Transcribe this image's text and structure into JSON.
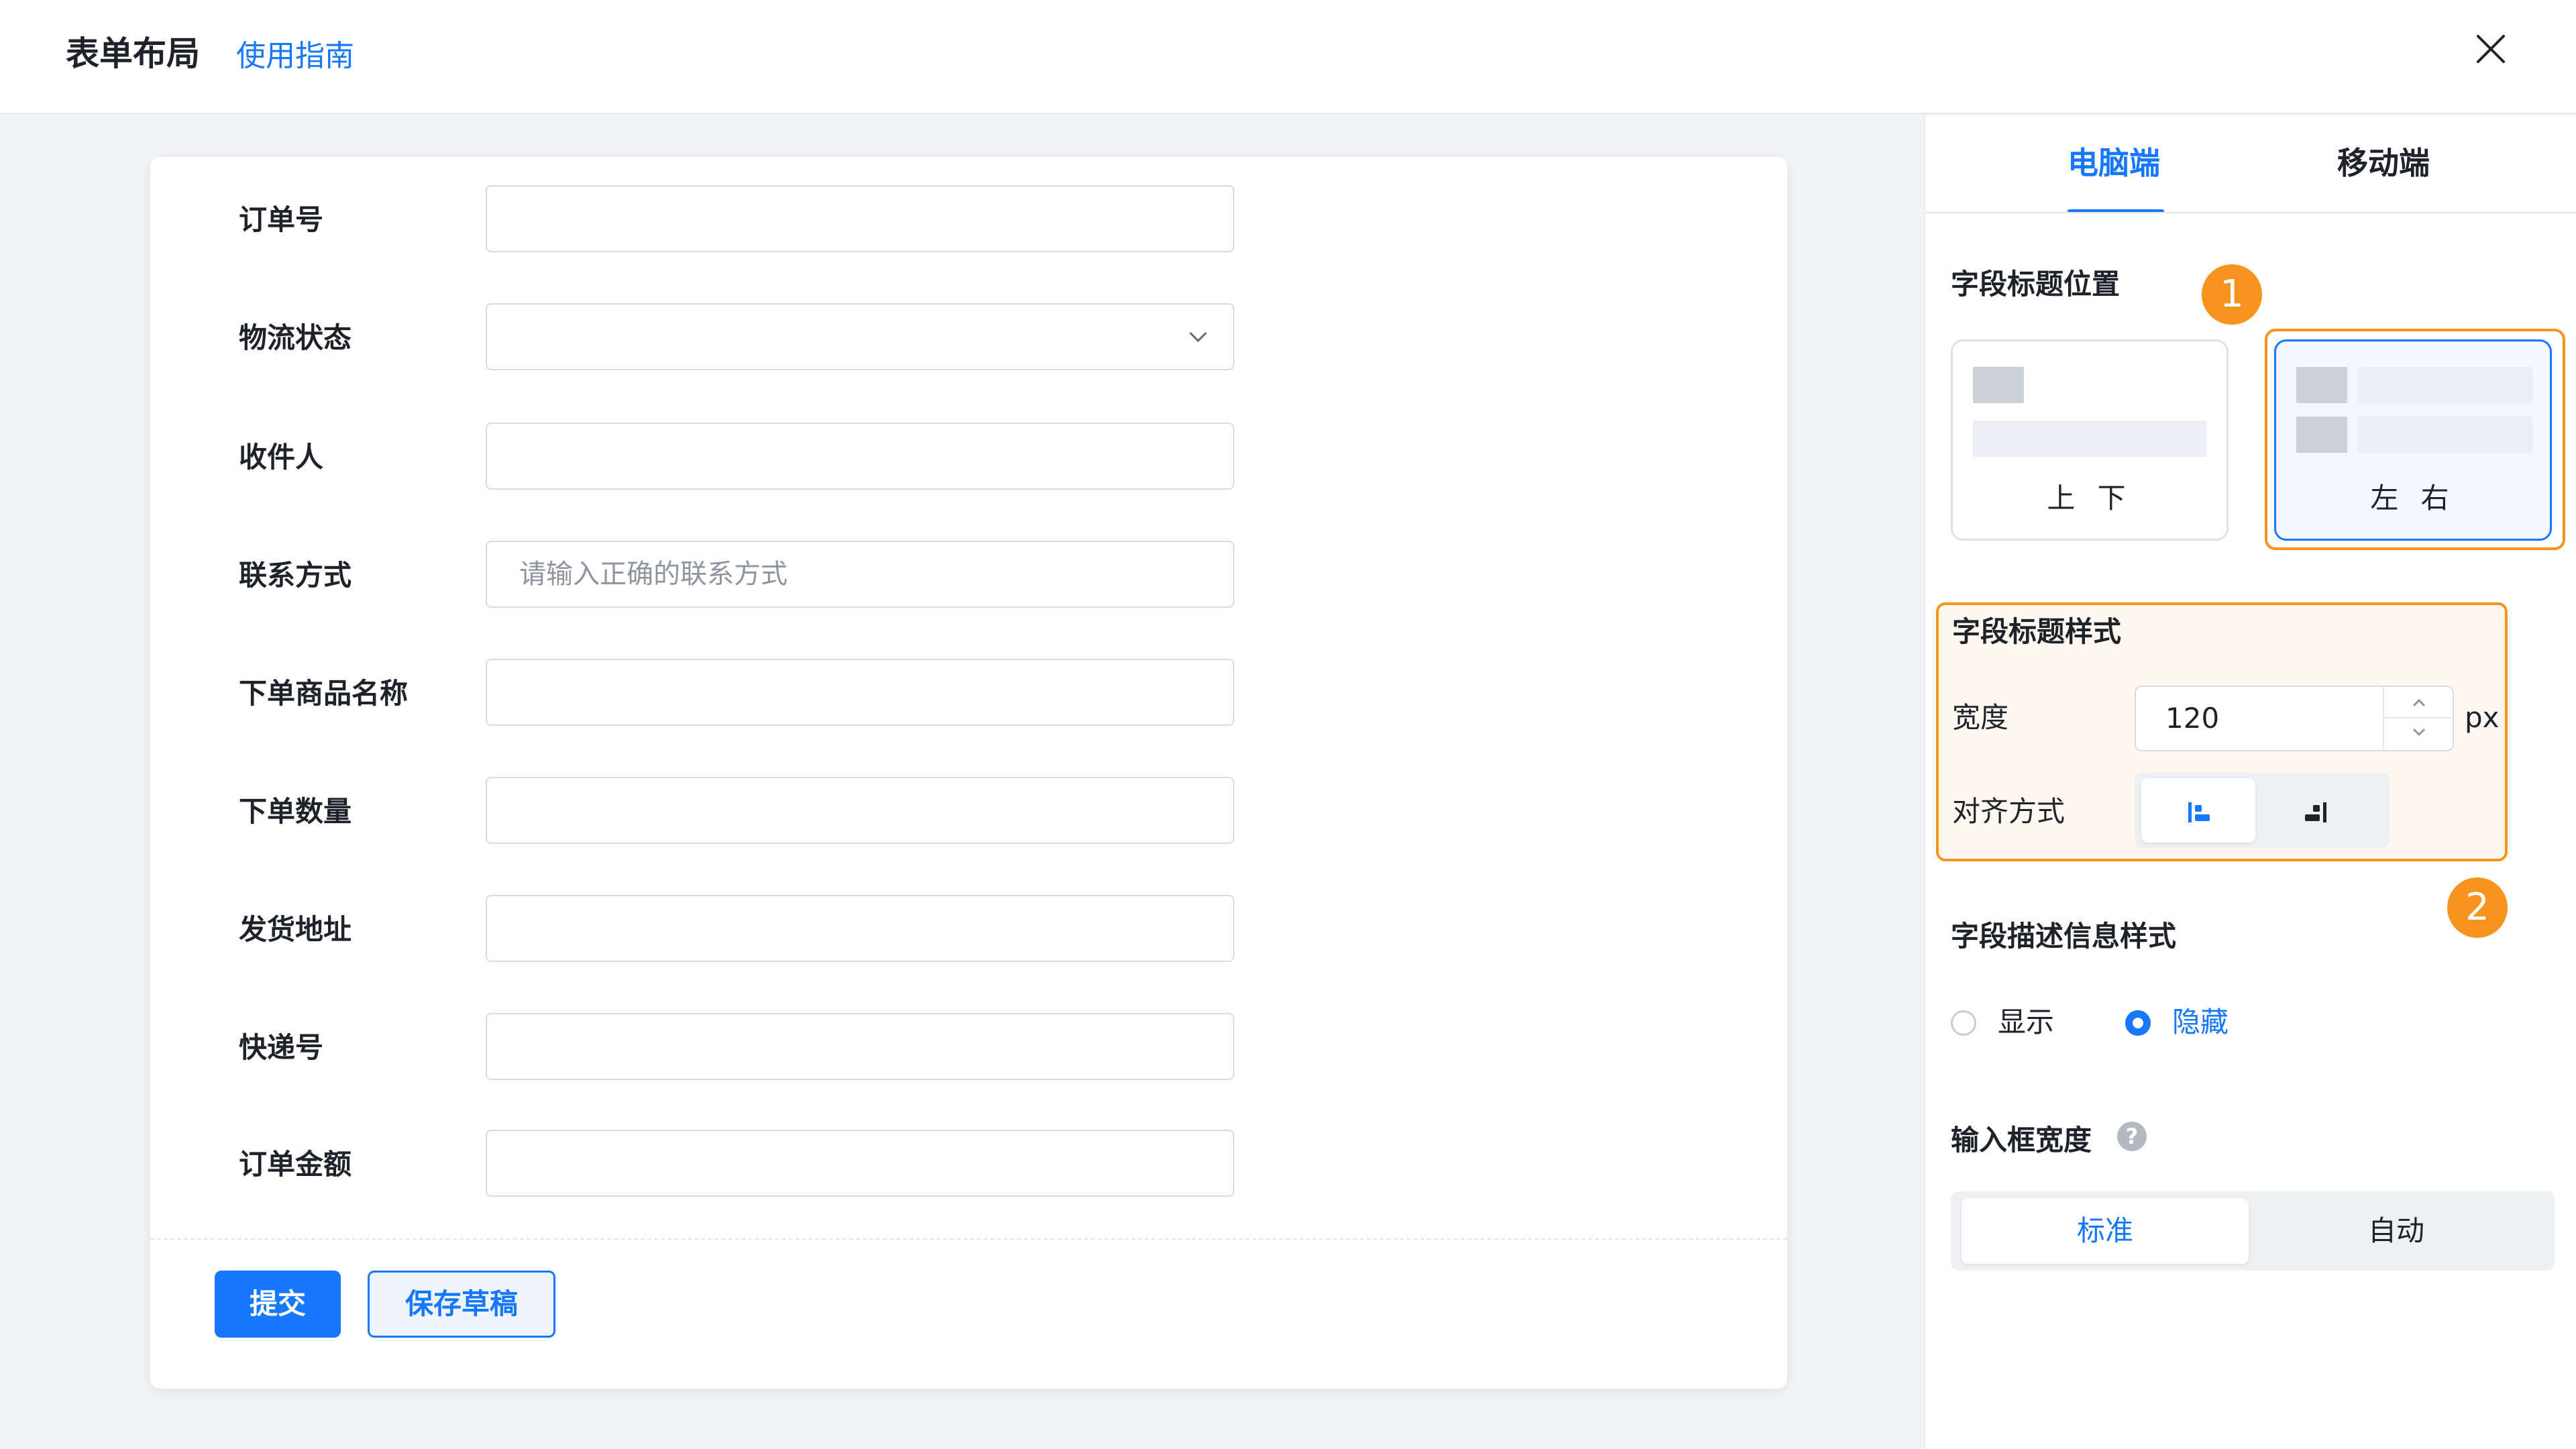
{
  "header": {
    "title": "表单布局",
    "guide_link": "使用指南",
    "close_icon": "close-icon"
  },
  "form": {
    "fields": [
      {
        "label": "订单号",
        "type": "text",
        "value": "",
        "placeholder": ""
      },
      {
        "label": "物流状态",
        "type": "select",
        "value": "",
        "placeholder": ""
      },
      {
        "label": "收件人",
        "type": "text",
        "value": "",
        "placeholder": ""
      },
      {
        "label": "联系方式",
        "type": "text",
        "value": "",
        "placeholder": "请输入正确的联系方式"
      },
      {
        "label": "下单商品名称",
        "type": "text",
        "value": "",
        "placeholder": ""
      },
      {
        "label": "下单数量",
        "type": "text",
        "value": "",
        "placeholder": ""
      },
      {
        "label": "发货地址",
        "type": "text",
        "value": "",
        "placeholder": ""
      },
      {
        "label": "快递号",
        "type": "text",
        "value": "",
        "placeholder": ""
      },
      {
        "label": "订单金额",
        "type": "text",
        "value": "",
        "placeholder": ""
      }
    ],
    "submit_label": "提交",
    "draft_label": "保存草稿"
  },
  "panel": {
    "tabs": [
      {
        "label": "电脑端",
        "active": true
      },
      {
        "label": "移动端",
        "active": false
      }
    ],
    "title_position": {
      "title": "字段标题位置",
      "badge": "1",
      "options": [
        {
          "label": "上 下",
          "selected": false
        },
        {
          "label": "左 右",
          "selected": true
        }
      ]
    },
    "title_style": {
      "title": "字段标题样式",
      "width_label": "宽度",
      "width_value": "120",
      "width_unit": "px",
      "align_label": "对齐方式",
      "align_options": [
        {
          "icon": "align-left-icon",
          "active": true
        },
        {
          "icon": "align-right-icon",
          "active": false
        }
      ],
      "badge": "2"
    },
    "description_style": {
      "title": "字段描述信息样式",
      "options": [
        {
          "label": "显示",
          "checked": false
        },
        {
          "label": "隐藏",
          "checked": true
        }
      ]
    },
    "input_width": {
      "title": "输入框宽度",
      "help_icon": "question-icon",
      "options": [
        {
          "label": "标准",
          "active": true
        },
        {
          "label": "自动",
          "active": false
        }
      ]
    }
  },
  "colors": {
    "accent": "#1677ff",
    "highlight": "#f7941d"
  }
}
